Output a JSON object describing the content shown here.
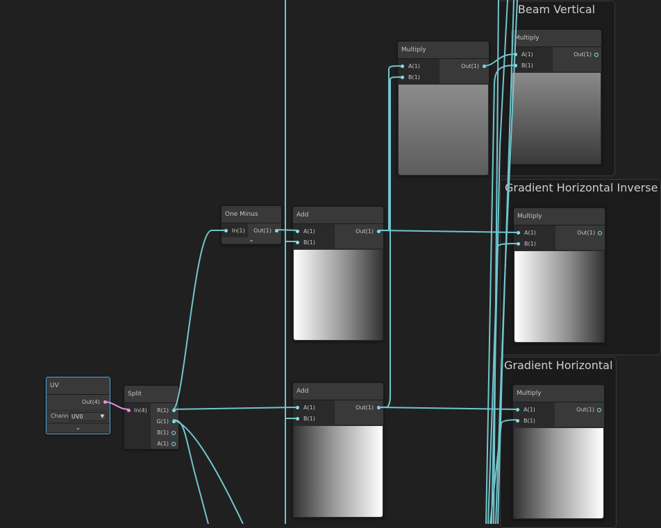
{
  "groups": {
    "beam_vertical": {
      "title": "Beam Vertical"
    },
    "gradient_horizontal_inverse": {
      "title": "Gradient Horizontal Inverse"
    },
    "gradient_horizontal": {
      "title": "Gradient Horizontal"
    }
  },
  "nodes": {
    "uv": {
      "title": "UV",
      "out": "Out(4)",
      "channel_label": "Channe",
      "channel_value": "UV0"
    },
    "split": {
      "title": "Split",
      "in": "In(4)",
      "r": "R(1)",
      "g": "G(1)",
      "b": "B(1)",
      "a": "A(1)"
    },
    "one_minus": {
      "title": "One Minus",
      "in": "In(1)",
      "out": "Out(1)"
    },
    "add_top": {
      "title": "Add",
      "a": "A(1)",
      "b": "B(1)",
      "out": "Out(1)"
    },
    "add_bottom": {
      "title": "Add",
      "a": "A(1)",
      "b": "B(1)",
      "out": "Out(1)"
    },
    "multiply_mid": {
      "title": "Multiply",
      "a": "A(1)",
      "b": "B(1)",
      "out": "Out(1)"
    },
    "multiply_beam": {
      "title": "Multiply",
      "a": "A(1)",
      "b": "B(1)",
      "out": "Out(1)"
    },
    "multiply_inverse": {
      "title": "Multiply",
      "a": "A(1)",
      "b": "B(1)",
      "out": "Out(1)"
    },
    "multiply_horizontal": {
      "title": "Multiply",
      "a": "A(1)",
      "b": "B(1)",
      "out": "Out(1)"
    }
  },
  "icons": {
    "collapse": "chevron-down-icon",
    "dropdown": "triangle-down-icon"
  },
  "colors": {
    "wire": "#72c6cf",
    "port_float": "#8de2ec",
    "port_vector4": "#e88ee0",
    "selection": "#4fa6d8",
    "background": "#202020"
  }
}
